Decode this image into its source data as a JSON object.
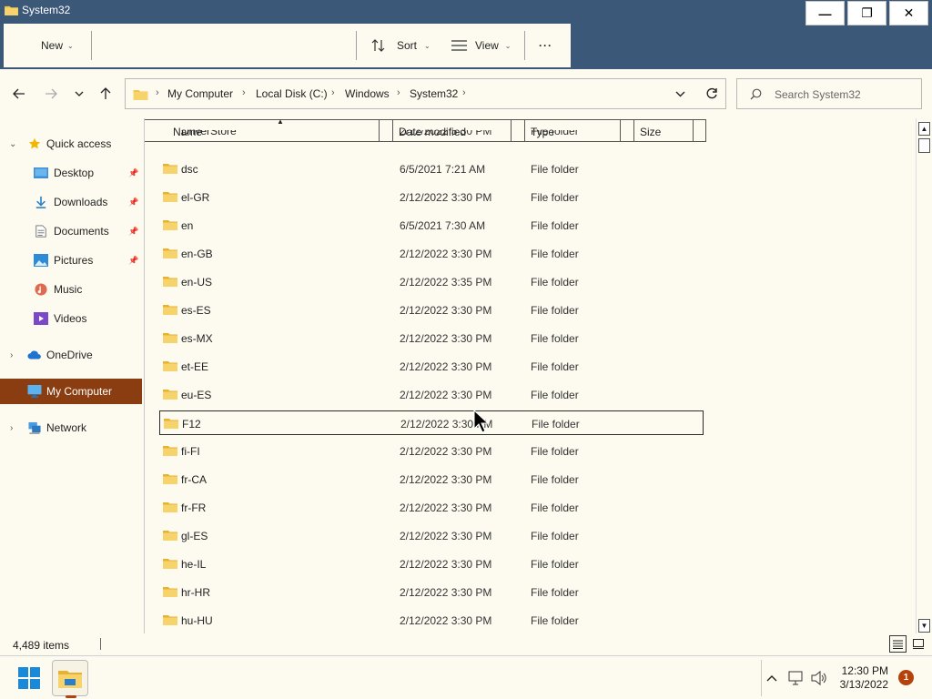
{
  "window": {
    "title": "System32",
    "minimize_label": "—",
    "restore_label": "❐",
    "close_label": "✕"
  },
  "toolbar": {
    "new_label": "New",
    "sort_label": "Sort",
    "view_label": "View",
    "more_label": "···"
  },
  "breadcrumb": [
    "My Computer",
    "Local Disk (C:)",
    "Windows",
    "System32"
  ],
  "search": {
    "placeholder": "Search System32"
  },
  "sidebar": {
    "quick_access": "Quick access",
    "desktop": "Desktop",
    "downloads": "Downloads",
    "documents": "Documents",
    "pictures": "Pictures",
    "music": "Music",
    "videos": "Videos",
    "onedrive": "OneDrive",
    "my_computer": "My Computer",
    "network": "Network"
  },
  "columns": {
    "name": "Name",
    "date": "Date modified",
    "type": "Type",
    "size": "Size"
  },
  "partial_row": {
    "name": "DriverStore",
    "date": "2/12/2022 3:30 PM",
    "type": "File folder"
  },
  "files": [
    {
      "name": "dsc",
      "date": "6/5/2021 7:21 AM",
      "type": "File folder"
    },
    {
      "name": "el-GR",
      "date": "2/12/2022 3:30 PM",
      "type": "File folder"
    },
    {
      "name": "en",
      "date": "6/5/2021 7:30 AM",
      "type": "File folder"
    },
    {
      "name": "en-GB",
      "date": "2/12/2022 3:30 PM",
      "type": "File folder"
    },
    {
      "name": "en-US",
      "date": "2/12/2022 3:35 PM",
      "type": "File folder"
    },
    {
      "name": "es-ES",
      "date": "2/12/2022 3:30 PM",
      "type": "File folder"
    },
    {
      "name": "es-MX",
      "date": "2/12/2022 3:30 PM",
      "type": "File folder"
    },
    {
      "name": "et-EE",
      "date": "2/12/2022 3:30 PM",
      "type": "File folder"
    },
    {
      "name": "eu-ES",
      "date": "2/12/2022 3:30 PM",
      "type": "File folder"
    },
    {
      "name": "F12",
      "date": "2/12/2022 3:30 PM",
      "type": "File folder"
    },
    {
      "name": "fi-FI",
      "date": "2/12/2022 3:30 PM",
      "type": "File folder"
    },
    {
      "name": "fr-CA",
      "date": "2/12/2022 3:30 PM",
      "type": "File folder"
    },
    {
      "name": "fr-FR",
      "date": "2/12/2022 3:30 PM",
      "type": "File folder"
    },
    {
      "name": "gl-ES",
      "date": "2/12/2022 3:30 PM",
      "type": "File folder"
    },
    {
      "name": "he-IL",
      "date": "2/12/2022 3:30 PM",
      "type": "File folder"
    },
    {
      "name": "hr-HR",
      "date": "2/12/2022 3:30 PM",
      "type": "File folder"
    },
    {
      "name": "hu-HU",
      "date": "2/12/2022 3:30 PM",
      "type": "File folder"
    }
  ],
  "status": {
    "item_count": "4,489 items"
  },
  "taskbar": {
    "time": "12:30 PM",
    "date": "3/13/2022",
    "notification_count": "1"
  },
  "colors": {
    "titlebar": "#3b5878",
    "selected": "#8a3d10",
    "folder": "#f3c44a",
    "background": "#fdfbf0"
  }
}
